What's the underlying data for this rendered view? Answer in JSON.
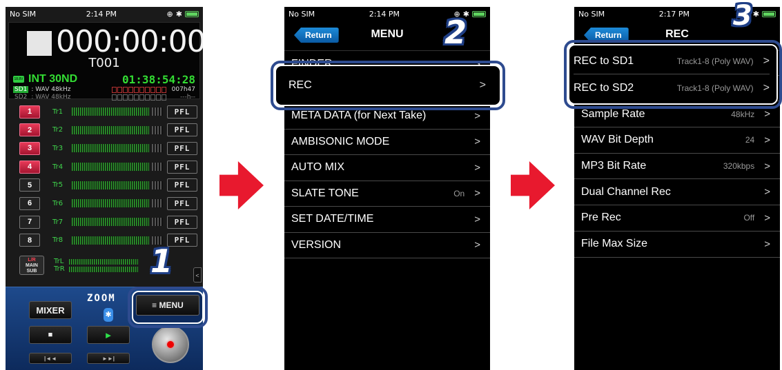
{
  "phone1": {
    "status": {
      "carrier": "No SIM",
      "time": "2:14 PM"
    },
    "counter": "000:00:00",
    "take": "T001",
    "battery_label": "18.8V EXT",
    "input_mode": "INT 30ND",
    "remaining": "01:38:54:28",
    "sd1": {
      "tag": "SD1",
      "format": ": WAV 48kHz",
      "time": "007h47"
    },
    "sd2": {
      "tag": "SD2",
      "format": ": WAV 48kHz",
      "time": "---h--"
    },
    "tracks": [
      {
        "num": "1",
        "name": "Tr1",
        "pfl": "PFL"
      },
      {
        "num": "2",
        "name": "Tr2",
        "pfl": "PFL"
      },
      {
        "num": "3",
        "name": "Tr3",
        "pfl": "PFL"
      },
      {
        "num": "4",
        "name": "Tr4",
        "pfl": "PFL"
      },
      {
        "num": "5",
        "name": "Tr5",
        "pfl": "PFL"
      },
      {
        "num": "6",
        "name": "Tr6",
        "pfl": "PFL"
      },
      {
        "num": "7",
        "name": "Tr7",
        "pfl": "PFL"
      },
      {
        "num": "8",
        "name": "Tr8",
        "pfl": "PFL"
      }
    ],
    "lr_button": {
      "line1": "L/R",
      "line2": "MAIN",
      "line3": "SUB"
    },
    "lr_tracks": [
      "TrL",
      "TrR"
    ],
    "buttons": {
      "mixer": "MIXER",
      "menu": "≡ MENU",
      "stop": "■",
      "play": "►",
      "rew": "|◄◄",
      "ff": "►►|"
    },
    "logo": "ZOOM",
    "side_tab": "<"
  },
  "phone2": {
    "status": {
      "carrier": "No SIM",
      "time": "2:14 PM"
    },
    "return_label": "Return",
    "title": "MENU",
    "items": [
      {
        "label": "FINDER",
        "value": ""
      },
      {
        "label": "REC",
        "value": ""
      },
      {
        "label": "META DATA (for Next Take)",
        "value": ""
      },
      {
        "label": "AMBISONIC MODE",
        "value": ""
      },
      {
        "label": "AUTO MIX",
        "value": ""
      },
      {
        "label": "SLATE TONE",
        "value": "On"
      },
      {
        "label": "SET DATE/TIME",
        "value": ""
      },
      {
        "label": "VERSION",
        "value": ""
      }
    ]
  },
  "phone3": {
    "status": {
      "carrier": "No SIM",
      "time": "2:17 PM"
    },
    "return_label": "Return",
    "title": "REC",
    "items": [
      {
        "label": "REC to SD1",
        "value": "Track1-8 (Poly WAV)"
      },
      {
        "label": "REC to SD2",
        "value": "Track1-8 (Poly WAV)"
      },
      {
        "label": "Sample Rate",
        "value": "48kHz"
      },
      {
        "label": "WAV Bit Depth",
        "value": "24"
      },
      {
        "label": "MP3 Bit Rate",
        "value": "320kbps"
      },
      {
        "label": "Dual Channel Rec",
        "value": ""
      },
      {
        "label": "Pre Rec",
        "value": "Off"
      },
      {
        "label": "File Max Size",
        "value": ""
      }
    ]
  },
  "steps": [
    "1",
    "2",
    "3"
  ],
  "colors": {
    "highlight": "#2e4b8f",
    "arrow": "#e8192e",
    "meter_green": "#2da32d",
    "armed_red": "#d42a48"
  }
}
